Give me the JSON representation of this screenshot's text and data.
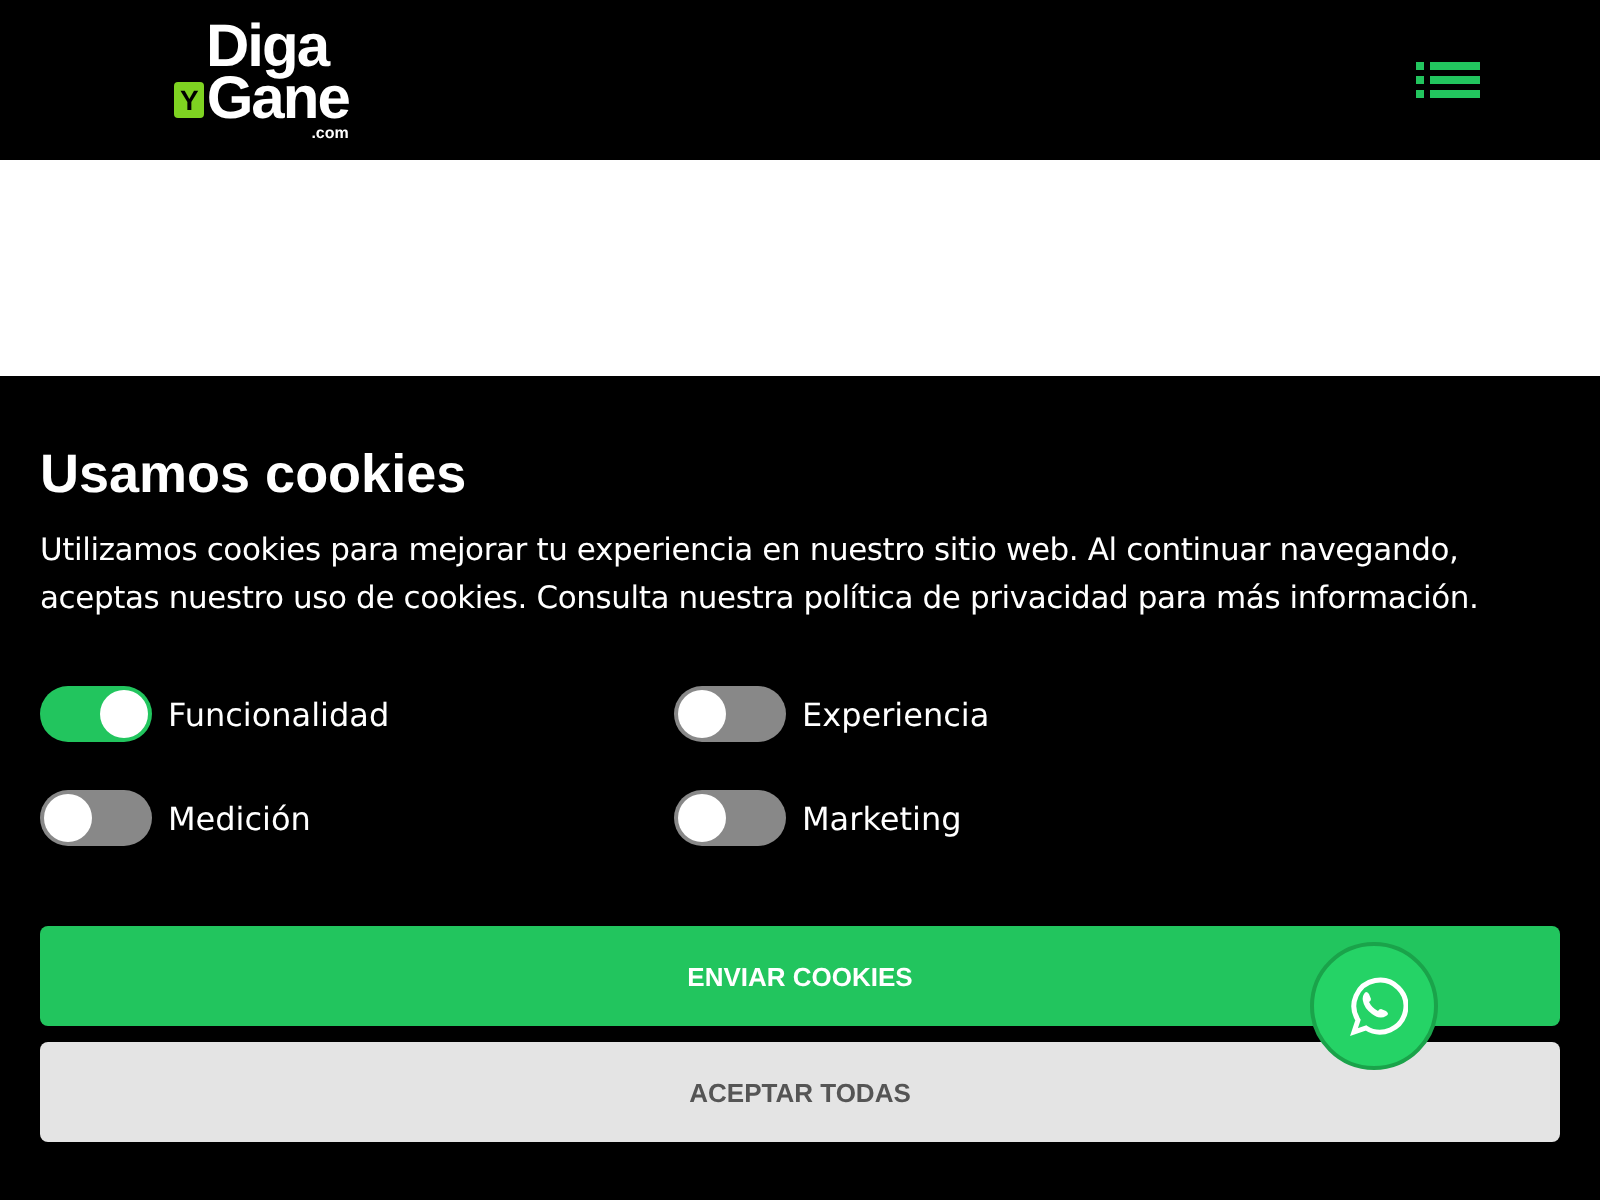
{
  "header": {
    "logo": {
      "top": "Diga",
      "badge": "Y",
      "bottom": "Gane",
      "domain": ".com"
    }
  },
  "cookie_banner": {
    "title": "Usamos cookies",
    "text": "Utilizamos cookies para mejorar tu experiencia en nuestro sitio web. Al continuar navegando, aceptas nuestro uso de cookies. Consulta nuestra política de privacidad para más información.",
    "options": [
      {
        "label": "Funcionalidad",
        "on": true
      },
      {
        "label": "Experiencia",
        "on": false
      },
      {
        "label": "Medición",
        "on": false
      },
      {
        "label": "Marketing",
        "on": false
      }
    ],
    "buttons": [
      {
        "label": "ENVIAR COOKIES",
        "kind": "primary"
      },
      {
        "label": "ACEPTAR TODAS",
        "kind": "secondary"
      }
    ]
  }
}
